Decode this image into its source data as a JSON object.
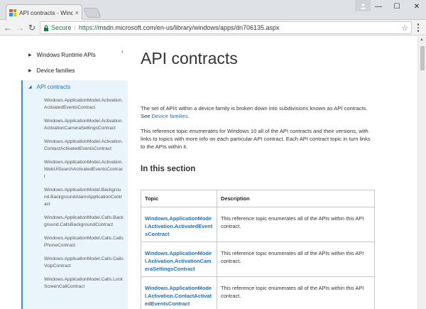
{
  "browser": {
    "tab_title": "API contracts - Windows",
    "tab_close": "×",
    "secure_label": "Secure",
    "url_scheme": "https://",
    "url_rest": "msdn.microsoft.com/en-us/library/windows/apps/dn706135.aspx",
    "back_icon": "←",
    "forward_icon": "→",
    "reload_icon": "↻",
    "star_icon": "☆",
    "minimize_icon": "—",
    "maximize_icon": "☐",
    "close_icon": "✕",
    "favicon_colors": [
      "#f25022",
      "#7fba00",
      "#00a4ef",
      "#ffb900"
    ]
  },
  "sidebar": {
    "collapse_icon": "‹",
    "top_items": [
      {
        "label": "Windows Runtime APIs",
        "arrow": "▶"
      },
      {
        "label": "Device families",
        "arrow": "▶"
      }
    ],
    "active": {
      "label": "API contracts",
      "arrow": "◢"
    },
    "sub_items": [
      "Windows.ApplicationModel.Activation.ActivatedEventsContract",
      "Windows.ApplicationModel.Activation.ActivationCameraSettingsContract",
      "Windows.ApplicationModel.Activation.ContactActivatedEventsContract",
      "Windows.ApplicationModel.Activation.WebUISearchActivatedEventsContract",
      "Windows.ApplicationModel.Background.BackgroundAlarmApplicationContract",
      "Windows.ApplicationModel.Calls.Background.CallsBackgroundContract",
      "Windows.ApplicationModel.Calls.CallsPhoneContract",
      "Windows.ApplicationModel.Calls.CallsVoipContract",
      "Windows.ApplicationModel.Calls.LockScreenCallContract"
    ]
  },
  "main": {
    "title": "API contracts",
    "intro_pre": "The set of APIs within a device family is broken down into subdivisions known as API contracts. See ",
    "intro_link": "Device families",
    "intro_post": ".",
    "para2": "This reference topic enumerates for Windows 10 all of the API contracts and their versions, with links to topics with more info on each particular API contract. Each API contract topic in turn links to the APIs within it.",
    "section_title": "In this section",
    "table": {
      "headers": [
        "Topic",
        "Description"
      ],
      "rows": [
        {
          "topic": "Windows.ApplicationModel.Activation.ActivatedEventsContract",
          "desc": "This reference topic enumerates all of the APIs within this API contract."
        },
        {
          "topic": "Windows.ApplicationModel.Activation.ActivationCameraSettingsContract",
          "desc": "This reference topic enumerates all of the APIs within this API contract."
        },
        {
          "topic": "Windows.ApplicationModel.Activation.ContactActivatedEventsContract",
          "desc": "This reference topic enumerates all of the APIs within this API contract."
        }
      ]
    }
  },
  "colors": {
    "link": "#1d70b8",
    "active_bg": "#eaf4fb",
    "secure_green": "#0b8043"
  }
}
